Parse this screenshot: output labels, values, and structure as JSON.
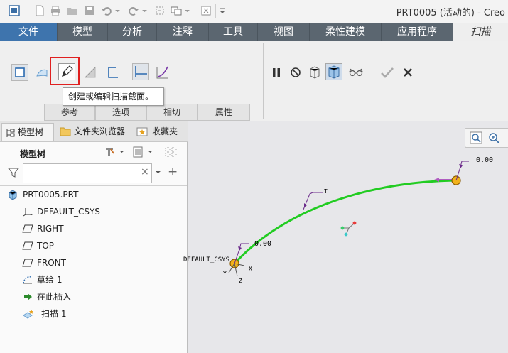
{
  "window": {
    "title": "PRT0005 (活动的) - Creo"
  },
  "menu": {
    "tabs": [
      {
        "label": "文件"
      },
      {
        "label": "模型"
      },
      {
        "label": "分析"
      },
      {
        "label": "注释"
      },
      {
        "label": "工具"
      },
      {
        "label": "视图"
      },
      {
        "label": "柔性建模"
      },
      {
        "label": "应用程序"
      },
      {
        "label": "扫描"
      }
    ]
  },
  "ribbon": {
    "groups": [
      {
        "label": "参考"
      },
      {
        "label": "选项"
      },
      {
        "label": "相切"
      },
      {
        "label": "属性"
      }
    ],
    "tooltip": "创建或编辑扫描截面。",
    "highlight_color": "#e02020"
  },
  "left_panel": {
    "tabs": [
      {
        "label": "模型树"
      },
      {
        "label": "文件夹浏览器"
      },
      {
        "label": "收藏夹"
      }
    ],
    "tree_header": "模型树",
    "filter": {
      "value": "",
      "clear": "×"
    },
    "tree": [
      {
        "label": "PRT0005.PRT",
        "icon": "part-icon"
      },
      {
        "label": "DEFAULT_CSYS",
        "icon": "csys-icon"
      },
      {
        "label": "RIGHT",
        "icon": "datum-plane-icon"
      },
      {
        "label": "TOP",
        "icon": "datum-plane-icon"
      },
      {
        "label": "FRONT",
        "icon": "datum-plane-icon"
      },
      {
        "label": "草绘 1",
        "icon": "sketch-icon"
      },
      {
        "label": "在此插入",
        "icon": "insert-here-arrow-icon"
      },
      {
        "label": "扫描 1",
        "icon": "sweep-feature-icon"
      }
    ]
  },
  "graphics": {
    "dim_start": "0.00",
    "dim_end": "0.00",
    "origin_label": "T",
    "csys_label": "DEFAULT_CSYS",
    "axis_x": "X",
    "axis_y": "Y",
    "axis_z": "Z",
    "trajectory_color": "#22cc22",
    "handle_color": "#f2b21a"
  }
}
